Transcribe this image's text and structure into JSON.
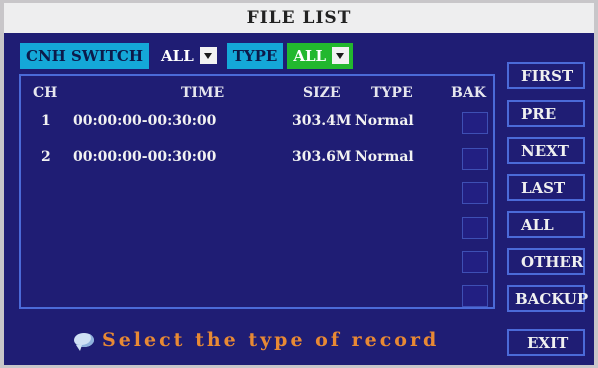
{
  "window": {
    "title": "FILE LIST"
  },
  "filters": {
    "channel_switch_label": "CNH SWITCH",
    "channel_value": "ALL",
    "type_label": "TYPE",
    "type_value": "ALL"
  },
  "table": {
    "headers": {
      "ch": "CH",
      "time": "TIME",
      "size": "SIZE",
      "type": "TYPE",
      "bak": "BAK"
    },
    "rows": [
      {
        "ch": "1",
        "time": "00:00:00-00:30:00",
        "size": "303.4M",
        "type": "Normal"
      },
      {
        "ch": "2",
        "time": "00:00:00-00:30:00",
        "size": "303.6M",
        "type": "Normal"
      }
    ]
  },
  "sidebar": {
    "first": "FIRST",
    "pre": "PRE",
    "next": "NEXT",
    "last": "LAST",
    "all": "ALL",
    "other": "OTHER",
    "backup": "BACKUP",
    "exit": "EXIT"
  },
  "status": {
    "message": "Select the type of record"
  },
  "colors": {
    "panel_bg": "#1f1d74",
    "border_blue": "#4b6ad8",
    "chip_cyan": "#14a8d8",
    "chip_green": "#22b82e",
    "status_orange": "#e88934"
  }
}
